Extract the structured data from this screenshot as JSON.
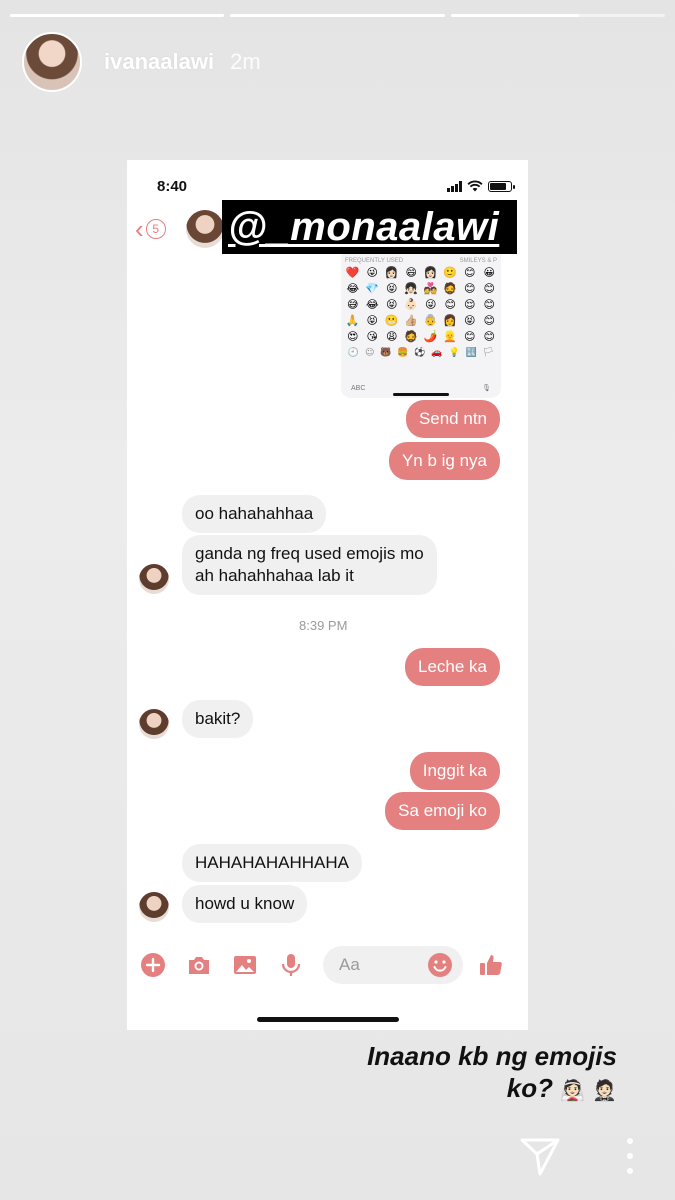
{
  "story": {
    "username": "ivanaalawi",
    "time_ago": "2m",
    "progress": [
      1,
      1,
      0.6
    ]
  },
  "phone": {
    "status_time": "8:40",
    "back_count": "5",
    "mention_tag": "@_monaalawi"
  },
  "keyboard": {
    "left_header": "FREQUENTLY USED",
    "right_header": "SMILEYS & P",
    "emojis": [
      "❤️",
      "😜",
      "👩🏻",
      "😄",
      "👩🏻",
      "🙂",
      "😊",
      "😀",
      "😂",
      "💎",
      "😝",
      "👧🏻",
      "💑",
      "🧔",
      "😊",
      "😊",
      "😅",
      "😂",
      "😝",
      "👶🏻",
      "😜",
      "😊",
      "😌",
      "😊",
      "🙏",
      "😝",
      "😬",
      "👍🏼",
      "👵",
      "👩",
      "😝",
      "😊",
      "😍",
      "😘",
      "😩",
      "🧔",
      "🌶️",
      "👱",
      "😊",
      "😊"
    ],
    "categories": [
      "🕘",
      "☺",
      "🐻",
      "🍔",
      "⚽",
      "🚗",
      "💡",
      "🔣",
      "🏳"
    ],
    "abc_label": "ABC"
  },
  "messages": [
    {
      "dir": "out",
      "text": "Send ntn"
    },
    {
      "dir": "out",
      "text": "Yn b ig nya"
    },
    {
      "dir": "in",
      "text": "oo hahahahhaa"
    },
    {
      "dir": "in",
      "text": "ganda ng freq used emojis mo\nah hahahhahaa lab it"
    },
    {
      "dir": "out",
      "text": "Leche ka"
    },
    {
      "dir": "in",
      "text": "bakit?"
    },
    {
      "dir": "out",
      "text": "Inggit ka"
    },
    {
      "dir": "out",
      "text": "Sa emoji ko"
    },
    {
      "dir": "in",
      "text": "HAHAHAHAHHAHA"
    },
    {
      "dir": "in",
      "text": "howd u know"
    }
  ],
  "timestamp": "8:39 PM",
  "composer": {
    "placeholder": "Aa"
  },
  "caption": {
    "line1": "Inaano kb ng emojis",
    "line2": "ko?",
    "emojis": "👰🏻 🤵🏻"
  },
  "colors": {
    "accent": "#e48080",
    "incoming_bubble": "#f0f0f0"
  }
}
